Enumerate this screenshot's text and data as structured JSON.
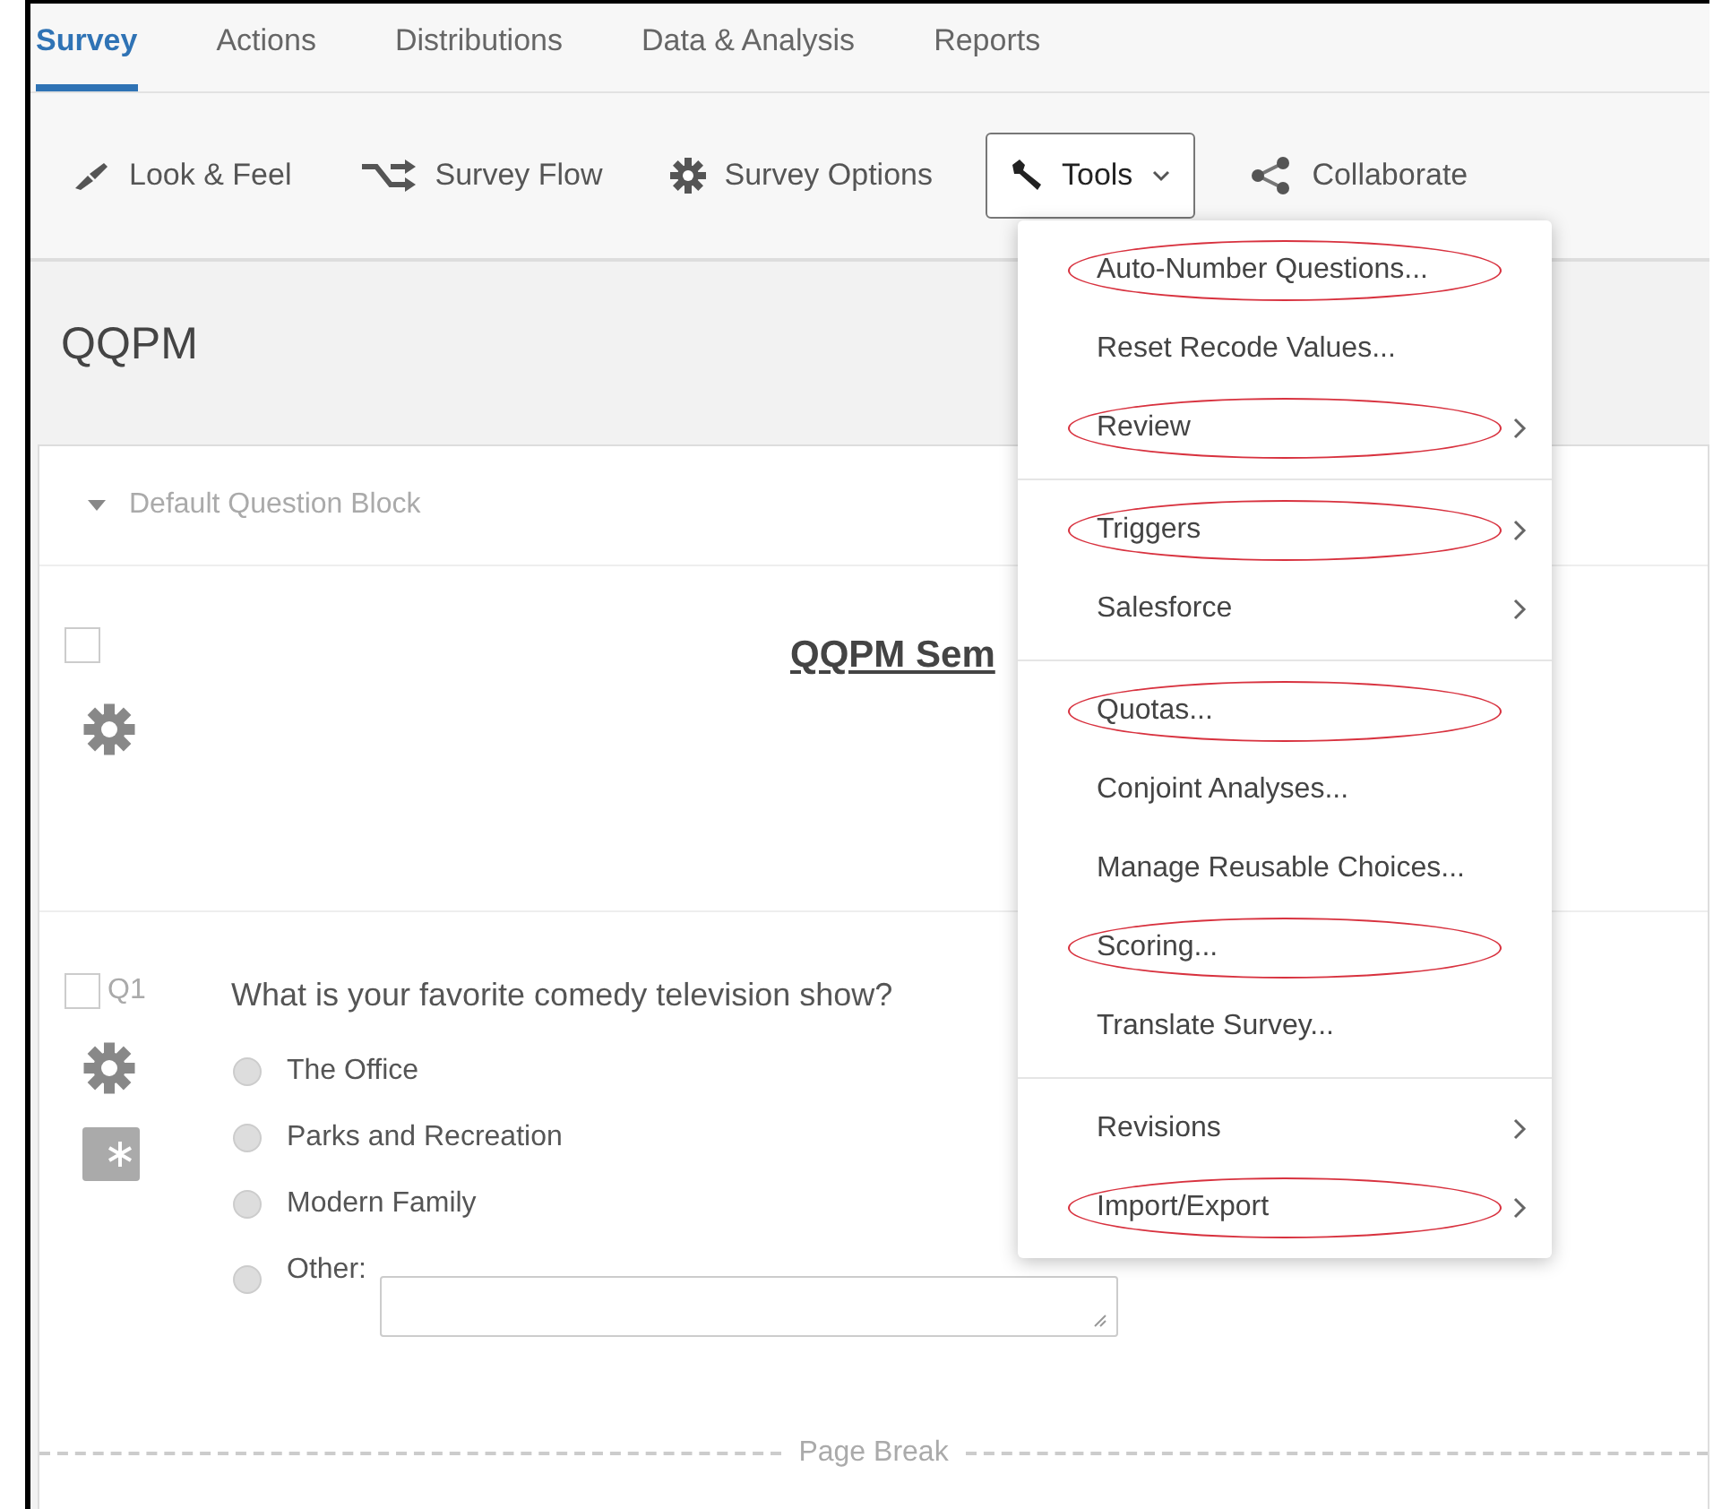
{
  "tabs": [
    {
      "label": "Survey",
      "selected": true
    },
    {
      "label": "Actions",
      "selected": false
    },
    {
      "label": "Distributions",
      "selected": false
    },
    {
      "label": "Data & Analysis",
      "selected": false
    },
    {
      "label": "Reports",
      "selected": false
    }
  ],
  "toolbar": [
    {
      "label": "Look & Feel",
      "kind": "plain"
    },
    {
      "label": "Survey Flow",
      "kind": "plain"
    },
    {
      "label": "Survey Options",
      "kind": "plain"
    },
    {
      "label": "Tools",
      "kind": "dropdown",
      "expanded": true
    },
    {
      "label": "Collaborate",
      "kind": "plain"
    }
  ],
  "survey_title": "QQPM",
  "block": {
    "title": "Default Question Block",
    "expanded": true
  },
  "intro": {
    "title": "QQPM Sem",
    "checked": false
  },
  "question": {
    "number": "Q1",
    "text": "What is your favorite comedy television show?",
    "checked": false,
    "required": true,
    "choices": [
      {
        "label": "The Office",
        "kind": "radio",
        "selected": false
      },
      {
        "label": "Parks and Recreation",
        "kind": "radio",
        "selected": false
      },
      {
        "label": "Modern Family",
        "kind": "radio",
        "selected": false
      },
      {
        "label": "Other:",
        "kind": "text_entry",
        "selected": false
      }
    ]
  },
  "page_break": "Page Break",
  "tools_menu": {
    "groups": [
      [
        {
          "label": "Auto-Number Questions...",
          "submenu": false,
          "highlighted": true
        },
        {
          "label": "Reset Recode Values...",
          "submenu": false,
          "highlighted": false
        },
        {
          "label": "Review",
          "submenu": true,
          "highlighted": true
        }
      ],
      [
        {
          "label": "Triggers",
          "submenu": true,
          "highlighted": true
        },
        {
          "label": "Salesforce",
          "submenu": true,
          "highlighted": false
        }
      ],
      [
        {
          "label": "Quotas...",
          "submenu": false,
          "highlighted": true
        },
        {
          "label": "Conjoint Analyses...",
          "submenu": false,
          "highlighted": false
        },
        {
          "label": "Manage Reusable Choices...",
          "submenu": false,
          "highlighted": false
        },
        {
          "label": "Scoring...",
          "submenu": false,
          "highlighted": true
        },
        {
          "label": "Translate Survey...",
          "submenu": false,
          "highlighted": false
        }
      ],
      [
        {
          "label": "Revisions",
          "submenu": true,
          "highlighted": false
        },
        {
          "label": "Import/Export",
          "submenu": true,
          "highlighted": true
        }
      ]
    ]
  }
}
